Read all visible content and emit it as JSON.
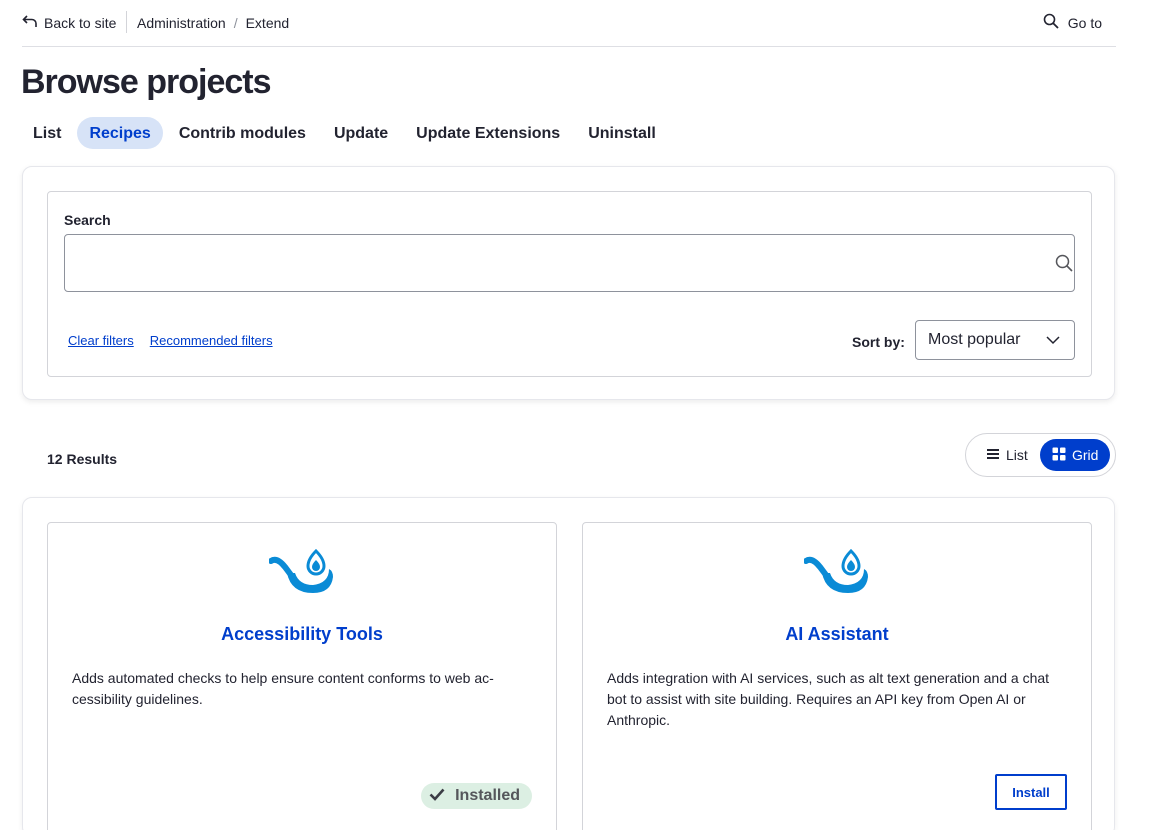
{
  "topbar": {
    "back_label": "Back to site",
    "breadcrumb": [
      "Administration",
      "Extend"
    ],
    "goto_label": "Go to"
  },
  "page_title": "Browse projects",
  "tabs": [
    {
      "label": "List",
      "active": false
    },
    {
      "label": "Recipes",
      "active": true
    },
    {
      "label": "Contrib modules",
      "active": false
    },
    {
      "label": "Update",
      "active": false
    },
    {
      "label": "Update Extensions",
      "active": false
    },
    {
      "label": "Uninstall",
      "active": false
    }
  ],
  "filters": {
    "search_label": "Search",
    "search_value": "",
    "clear_filters": "Clear filters",
    "recommended_filters": "Recommended filters",
    "sort_label": "Sort by:",
    "sort_value": "Most popular"
  },
  "results": {
    "count_label": "12 Results",
    "view_list": "List",
    "view_grid": "Grid",
    "active_view": "grid"
  },
  "projects": [
    {
      "title": "Accessibility Tools",
      "description": "Adds automated checks to help ensure content conforms to web ac­cessibility guidelines.",
      "status": "Installed",
      "icon": "recipe-pan-icon"
    },
    {
      "title": "AI Assistant",
      "description": "Adds integration with AI services, such as alt text generation and a chat bot to assist with site building. Requires an API key from Open AI or Anthropic.",
      "action": "Install",
      "icon": "recipe-pan-icon"
    }
  ],
  "colors": {
    "accent": "#003ecc",
    "tab_active_bg": "#d7e3f7",
    "logo": "#0a8bd6",
    "installed_bg": "#dcefe3"
  }
}
